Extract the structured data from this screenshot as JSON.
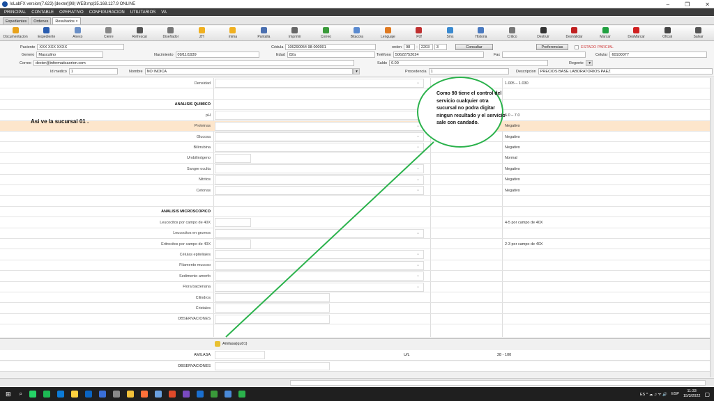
{
  "window": {
    "title": "IoLabFX version(7.623)  [dexter]|98| WEB:mp|35.168.127.9 ONLINE",
    "controls": [
      "–",
      "❐",
      "✕"
    ]
  },
  "menu": [
    "PRINCIPAL",
    "CONTABLE",
    "OPERATIVO",
    "CONFIGURACION",
    "UTILITARIOS",
    "VA"
  ],
  "tabs": [
    {
      "label": "Expedientes"
    },
    {
      "label": "Ordenes"
    },
    {
      "label": "Resultados ×"
    }
  ],
  "toolbar": [
    {
      "label": "Documentacion",
      "color": "#e8a21a"
    },
    {
      "label": "Expediente",
      "color": "#2a5db0"
    },
    {
      "label": "Anexo",
      "color": "#6a8fc7"
    },
    {
      "label": "Cierre",
      "color": "#888888"
    },
    {
      "label": "Refrescar",
      "color": "#555555"
    },
    {
      "label": "Diseñador",
      "color": "#777777"
    },
    {
      "label": "ZH",
      "color": "#f0b020"
    },
    {
      "label": "mima",
      "color": "#f0b020"
    },
    {
      "label": "Pantalla",
      "color": "#4a6fb0"
    },
    {
      "label": "Imprimir",
      "color": "#666666"
    },
    {
      "label": "Correo",
      "color": "#3a9a3a"
    },
    {
      "label": "Bitacora",
      "color": "#5a8ad0"
    },
    {
      "label": "Lenguaje",
      "color": "#e07a20"
    },
    {
      "label": "Pdf",
      "color": "#c03030"
    },
    {
      "label": "Sms",
      "color": "#3a8ad0"
    },
    {
      "label": "Historia",
      "color": "#4a7ac0"
    },
    {
      "label": "Critico",
      "color": "#777777"
    },
    {
      "label": "Destruir",
      "color": "#333333"
    },
    {
      "label": "DesValidar",
      "color": "#c02020"
    },
    {
      "label": "Marcar",
      "color": "#20a040"
    },
    {
      "label": "DesMarcar",
      "color": "#d02020"
    },
    {
      "label": "Oficial",
      "color": "#444444"
    },
    {
      "label": "Salvar",
      "color": "#555555"
    }
  ],
  "patient": {
    "paciente_label": "Paciente",
    "paciente": "XXX XXX XXXX",
    "cedula_label": "Cédula",
    "cedula": "106290054  98-000001",
    "orden_label": "orden",
    "orden_a": "98",
    "orden_b": "2203",
    "orden_c": "3",
    "consultar": "Consultar",
    "preferencias": "Preferencias",
    "estado": "ESTADO PARCIAL",
    "genero_label": "Genero",
    "genero": "Masculino",
    "nacimiento_label": "Nacimiento",
    "nacimiento": "09/11/1939",
    "edad_label": "Edad",
    "edad": "82a",
    "telefono_label": "Teléfono",
    "telefono": "50622752024",
    "fax_label": "Fax",
    "fax": "",
    "celular_label": "Celular",
    "celular": "60100077",
    "correo_label": "Correo",
    "correo": "dexter@informaticaorion.com",
    "saldo_label": "Saldo",
    "saldo": "0.00",
    "regente_label": "Regente",
    "idmedico_label": "Id medico",
    "idmedico": "1",
    "nombre_label": "Nombre",
    "nombre": "NO INDICA",
    "procedencia_label": "Procedencia",
    "procedencia": "1",
    "descripcion_label": "Descripcion",
    "descripcion": "PRECIOS BASE LABORATORIOS PAEZ"
  },
  "results": [
    {
      "name": "Densidad",
      "ref": "1.005 – 1.030",
      "dd": true
    },
    {
      "name": "",
      "ref": ""
    },
    {
      "name": "ANALISIS QUIMICO",
      "section": true,
      "ref": ""
    },
    {
      "name": "pH",
      "ref": "5.0 – 7.0",
      "dd": true
    },
    {
      "name": "Proteinas",
      "ref": "Negativo",
      "dd": true,
      "hl": true
    },
    {
      "name": "Glucosa",
      "ref": "Negativo",
      "dd": true
    },
    {
      "name": "Bilirrubina",
      "ref": "Negativo",
      "dd": true
    },
    {
      "name": "Urobilinógeno",
      "ref": "Normal"
    },
    {
      "name": "Sangre oculta",
      "ref": "Negativo",
      "dd": true
    },
    {
      "name": "Nitritos",
      "ref": "Negativo",
      "dd": true
    },
    {
      "name": "Cetonas",
      "ref": "Negativo",
      "dd": true
    },
    {
      "name": "",
      "ref": ""
    },
    {
      "name": "ANALISIS MICROSCOPICO",
      "section": true,
      "ref": ""
    },
    {
      "name": "Leucocitos por campo de 40X",
      "ref": "4-5 por campo de 40X"
    },
    {
      "name": "Leucocitos en grumos",
      "ref": "",
      "dd": true
    },
    {
      "name": "Eritrocitos por campo de 40X",
      "ref": "2-3 por campo de 40X"
    },
    {
      "name": "Células epiteliales",
      "ref": "",
      "dd": true
    },
    {
      "name": "Filamento mucoso",
      "ref": "",
      "dd": true
    },
    {
      "name": "Sedimento amorfo",
      "ref": "",
      "dd": true
    },
    {
      "name": "Flora bacteriana",
      "ref": "",
      "dd": true
    },
    {
      "name": "Cilindros",
      "ref": ""
    },
    {
      "name": "Cristales",
      "ref": ""
    },
    {
      "name": "OBSERVACIONES",
      "ref": ""
    }
  ],
  "annotation": {
    "sucursal": "Asi ve la sucursal 01 .",
    "callout": "Como 98 tiene el control del servicio cualquier otra sucursal no podra digitar ningun resultado y el servicio sale con candado."
  },
  "bottom": {
    "header": "Amilasa(qu01)",
    "rows": [
      {
        "name": "AMILASA",
        "unit": "U/L",
        "ref": "28 - 100"
      },
      {
        "name": "OBSERVACIONES",
        "unit": "",
        "ref": ""
      }
    ]
  },
  "taskbar": {
    "lang": "ESP",
    "time": "11:33",
    "date": "15/3/2022",
    "tray": "ES  ^  ☁  ♫  ᯤ  🔊"
  }
}
